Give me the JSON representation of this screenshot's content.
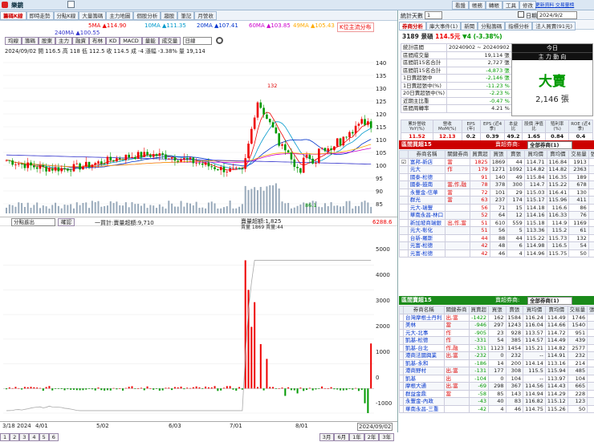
{
  "top": {
    "logo": "樂鏡",
    "right_links": [
      "看盤",
      "帳務",
      "轉帳",
      "工具",
      "修改"
    ]
  },
  "left_tabs": [
    "籌碼K線",
    "即時走勢",
    "分點K線",
    "大量籌碼",
    "主力地圖",
    "個股分析",
    "趨股",
    "筆記",
    "月營收"
  ],
  "legend": [
    {
      "t": "5MA ▲114.90",
      "c": "#e00"
    },
    {
      "t": "10MA ▲111.35",
      "c": "#09c"
    },
    {
      "t": "20MA ▲107.41",
      "c": "#03c"
    },
    {
      "t": "60MA ▲103.85",
      "c": "#c0c"
    },
    {
      "t": "49MA ▲105.43",
      "c": "#fa0"
    },
    {
      "t": "240MA ▲100.55",
      "c": "#33c"
    }
  ],
  "legend_right": "K位主流分布",
  "toolbar": {
    "buttons": [
      "均線",
      "籌碼",
      "股東",
      "主力",
      "融資",
      "布林",
      "KD",
      "MACD",
      "量能",
      "成交量"
    ],
    "period": "日線"
  },
  "ohlc": "2024/09/02  開 116.5  高 118  低 112.5  收 114.5   成 -4  漲幅 -3.38%  量 19,114",
  "price_axis": [
    "140",
    "135",
    "130",
    "125",
    "120",
    "115",
    "110",
    "105",
    "100",
    "95",
    "90",
    "85"
  ],
  "peak_label": "132",
  "low_label": "86.1",
  "lower": {
    "select": "分點進出",
    "btn": "確認",
    "title": "一買計:賣量超額:9,710",
    "right1": "賣量超額:1,825",
    "right2": "賣量 1869 賣量:44",
    "axis": [
      "6288.6",
      "5000",
      "4000",
      "3000",
      "2000",
      "1000",
      "0",
      "-1000"
    ]
  },
  "dates": [
    "3/18\n2024",
    "4/01",
    "5/02",
    "6/03",
    "7/01",
    "8/01",
    "2024/09/02"
  ],
  "bottom_pages": [
    "1",
    "2",
    "3",
    "4",
    "5",
    "6"
  ],
  "bottom_ranges": [
    "3月",
    "6月",
    "1年",
    "2年",
    "3年"
  ],
  "right_top": {
    "label": "統計天數",
    "days": "1",
    "date_label": "日期",
    "date": "2024/9/2",
    "links": [
      "更新資料",
      "交易量榜",
      "行事曆",
      "股價產生"
    ]
  },
  "right_tabs": [
    "券商分析",
    "庫大事件(1)",
    "新聞",
    "分點籌碼",
    "指標分析",
    "法人買賣(91元)"
  ],
  "stock": {
    "code_name": "3189 景碩",
    "price": "114.5元",
    "change": "▼4 (-3.38%)"
  },
  "stats": [
    [
      "統計區間",
      "20240902 ~ 20240902"
    ],
    [
      "區間成交量",
      "19,114 張"
    ],
    [
      "區間前15名合計",
      "2,727 張"
    ],
    [
      "區間前15名合計",
      "-4,873 張"
    ],
    [
      "1日賣超張中",
      "-2,146 張"
    ],
    [
      "1日賣超張中(%)",
      "-11.23 %"
    ],
    [
      "20日賣超張中(%)",
      "-2.23 %"
    ],
    [
      "近期主比重",
      "-0.47 %"
    ],
    [
      "區間周轉率",
      "4.21 %"
    ]
  ],
  "today": {
    "title": "今日",
    "sub": "主 力 動 向",
    "big": "大賣",
    "amount": "2,146 張"
  },
  "metrics_head": [
    "累計營收 YoY(%)",
    "營收 MoM(%)",
    "EPS (年)",
    "EPS (近4季)",
    "本益比",
    "股價 淨值比",
    "殖利率 (%)",
    "ROE (近4季)"
  ],
  "metrics": [
    "11.52",
    "12.13",
    "0.2",
    "0.39",
    "49.2",
    "1.65",
    "0.84",
    "0.4"
  ],
  "buy": {
    "title": "區間買超15",
    "ctrl": "賣超券商:",
    "ctrl_sel": "全部券商(1)",
    "cols": [
      "",
      "券商名稱",
      "關鍵券商",
      "買賣超",
      "買張",
      "賣張",
      "買均價",
      "賣均價",
      "交易量",
      "張數(%)"
    ],
    "rows": [
      [
        "☑",
        "富邦-新店",
        "當",
        "1825",
        "1869",
        "44",
        "114.71",
        "116.84",
        "1913",
        "-29"
      ],
      [
        "",
        "元大",
        "作",
        "179",
        "1271",
        "1092",
        "114.82",
        "114.82",
        "2363",
        "-6"
      ],
      [
        "",
        "國泰-松德",
        "",
        "91",
        "140",
        "49",
        "115.84",
        "116.35",
        "189",
        "-10"
      ],
      [
        "",
        "國泰-鼓南",
        "當,作,融",
        "78",
        "378",
        "300",
        "114.7",
        "115.22",
        "678",
        "14"
      ],
      [
        "",
        "永豐金-信華",
        "當",
        "72",
        "101",
        "29",
        "115.03",
        "116.41",
        "130",
        "0"
      ],
      [
        "",
        "群光",
        "當",
        "63",
        "237",
        "174",
        "115.17",
        "115.96",
        "411",
        "10"
      ],
      [
        "",
        "元大-瑞豐",
        "",
        "56",
        "71",
        "15",
        "114.18",
        "116.6",
        "86",
        "5"
      ],
      [
        "",
        "華南永昌-林口",
        "",
        "52",
        "64",
        "12",
        "114.16",
        "116.33",
        "76",
        "-8"
      ],
      [
        "",
        "新加坡商瑞銀",
        "出,作,當",
        "51",
        "610",
        "559",
        "115.18",
        "114.9",
        "1169",
        "-19"
      ],
      [
        "",
        "元大-彰化",
        "",
        "51",
        "56",
        "5",
        "113.36",
        "115.2",
        "61",
        "7"
      ],
      [
        "",
        "台新-羅斯",
        "",
        "44",
        "88",
        "44",
        "115.22",
        "115.73",
        "132",
        "-1"
      ],
      [
        "",
        "元富-松德",
        "",
        "42",
        "48",
        "6",
        "114.98",
        "116.5",
        "54",
        "-7"
      ],
      [
        "",
        "元富-松德",
        "",
        "42",
        "46",
        "4",
        "114.96",
        "115.75",
        "50",
        "-2"
      ]
    ]
  },
  "sell": {
    "title": "區間賣超15",
    "ctrl": "賣超券商:",
    "ctrl_sel": "全部券商(1)",
    "cols": [
      "",
      "券商名稱",
      "關鍵券商",
      "買賣超",
      "買張",
      "賣張",
      "買均價",
      "賣均價",
      "交易量",
      "張數(%)"
    ],
    "rows": [
      [
        "",
        "台灣摩根士丹利",
        "出,當",
        "-1422",
        "162",
        "1584",
        "116.24",
        "114.49",
        "1746",
        "-30"
      ],
      [
        "",
        "美林",
        "當",
        "-946",
        "297",
        "1243",
        "116.04",
        "114.66",
        "1540",
        "-51"
      ],
      [
        "",
        "元大-北事",
        "作",
        "-905",
        "23",
        "928",
        "113.57",
        "114.72",
        "951",
        "23"
      ],
      [
        "",
        "凱基-松德",
        "作",
        "-331",
        "54",
        "385",
        "114.57",
        "114.49",
        "439",
        "-1"
      ],
      [
        "",
        "凱基-台北",
        "作,融",
        "-331",
        "1123",
        "1454",
        "115.21",
        "114.82",
        "2577",
        "-13"
      ],
      [
        "",
        "港商法國興業",
        "出,當",
        "-232",
        "0",
        "232",
        "--",
        "114.91",
        "232",
        "10"
      ],
      [
        "",
        "凱基-永和",
        "",
        "-186",
        "14",
        "200",
        "114.14",
        "113.16",
        "214",
        "-26"
      ],
      [
        "",
        "港商野村",
        "出,當",
        "-131",
        "177",
        "308",
        "115.5",
        "115.94",
        "485",
        "27"
      ],
      [
        "",
        "凱基",
        "出",
        "-104",
        "0",
        "104",
        "--",
        "113.97",
        "104",
        "-10"
      ],
      [
        "",
        "摩根大通",
        "出,當",
        "-69",
        "298",
        "367",
        "114.56",
        "114.43",
        "665",
        "-4"
      ],
      [
        "",
        "群益金鼎",
        "當",
        "-58",
        "85",
        "143",
        "114.94",
        "114.29",
        "228",
        "-7"
      ],
      [
        "",
        "永豐金-內政",
        "",
        "-43",
        "40",
        "83",
        "116.82",
        "115.12",
        "123",
        "4"
      ],
      [
        "",
        "華南永昌-三重",
        "",
        "-42",
        "4",
        "46",
        "114.75",
        "115.26",
        "50",
        "3"
      ]
    ]
  },
  "chart_data": {
    "type": "candlestick+bar",
    "price_range": [
      85,
      140
    ],
    "peak": 132,
    "low": 86.1,
    "last_close": 114.5,
    "net_axis_range": [
      -1000,
      6288.6
    ]
  }
}
